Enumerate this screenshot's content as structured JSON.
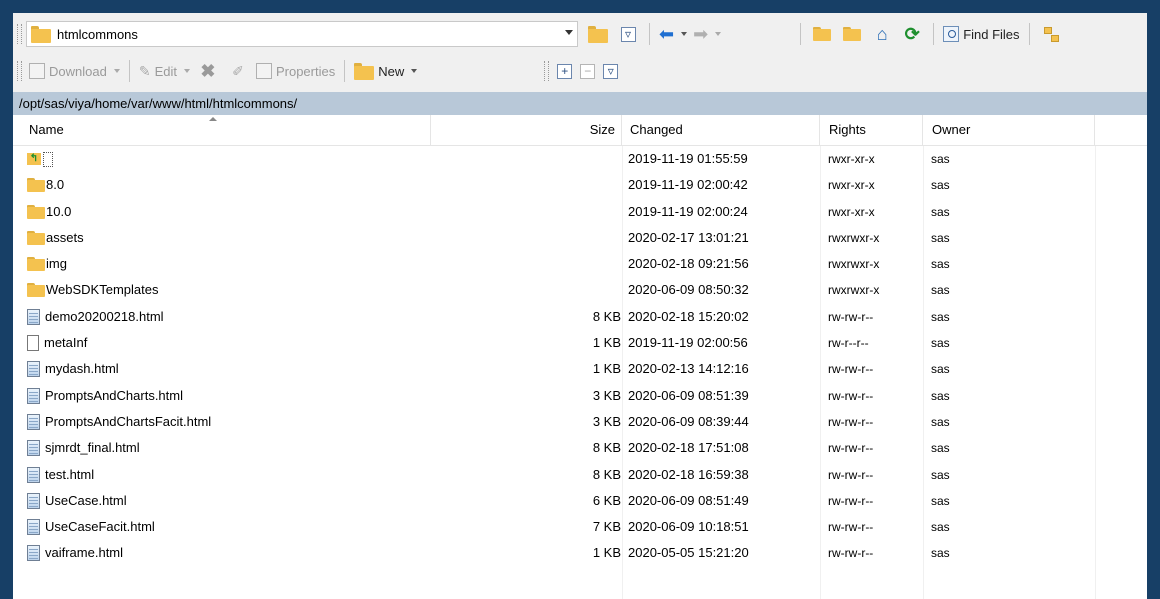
{
  "toolbar": {
    "current_folder": "htmlcommons",
    "nav_back_label": "←",
    "find_files_label": "Find Files",
    "download_label": "Download",
    "edit_label": "Edit",
    "properties_label": "Properties",
    "new_label": "New"
  },
  "address": {
    "path": "/opt/sas/viya/home/var/www/html/htmlcommons/"
  },
  "columns": {
    "name": "Name",
    "size": "Size",
    "changed": "Changed",
    "rights": "Rights",
    "owner": "Owner"
  },
  "files": [
    {
      "name": "..",
      "size": "",
      "changed": "2019-11-19 01:55:59",
      "rights": "rwxr-xr-x",
      "owner": "sas",
      "icon": "parent-folder-icon"
    },
    {
      "name": "8.0",
      "size": "",
      "changed": "2019-11-19 02:00:42",
      "rights": "rwxr-xr-x",
      "owner": "sas",
      "icon": "folder-icon"
    },
    {
      "name": "10.0",
      "size": "",
      "changed": "2019-11-19 02:00:24",
      "rights": "rwxr-xr-x",
      "owner": "sas",
      "icon": "folder-icon"
    },
    {
      "name": "assets",
      "size": "",
      "changed": "2020-02-17 13:01:21",
      "rights": "rwxrwxr-x",
      "owner": "sas",
      "icon": "folder-icon"
    },
    {
      "name": "img",
      "size": "",
      "changed": "2020-02-18 09:21:56",
      "rights": "rwxrwxr-x",
      "owner": "sas",
      "icon": "folder-icon"
    },
    {
      "name": "WebSDKTemplates",
      "size": "",
      "changed": "2020-06-09 08:50:32",
      "rights": "rwxrwxr-x",
      "owner": "sas",
      "icon": "folder-icon"
    },
    {
      "name": "demo20200218.html",
      "size": "8 KB",
      "changed": "2020-02-18 15:20:02",
      "rights": "rw-rw-r--",
      "owner": "sas",
      "icon": "html-file-icon"
    },
    {
      "name": "metaInf",
      "size": "1 KB",
      "changed": "2019-11-19 02:00:56",
      "rights": "rw-r--r--",
      "owner": "sas",
      "icon": "file-icon"
    },
    {
      "name": "mydash.html",
      "size": "1 KB",
      "changed": "2020-02-13 14:12:16",
      "rights": "rw-rw-r--",
      "owner": "sas",
      "icon": "html-file-icon"
    },
    {
      "name": "PromptsAndCharts.html",
      "size": "3 KB",
      "changed": "2020-06-09 08:51:39",
      "rights": "rw-rw-r--",
      "owner": "sas",
      "icon": "html-file-icon"
    },
    {
      "name": "PromptsAndChartsFacit.html",
      "size": "3 KB",
      "changed": "2020-06-09 08:39:44",
      "rights": "rw-rw-r--",
      "owner": "sas",
      "icon": "html-file-icon"
    },
    {
      "name": "sjmrdt_final.html",
      "size": "8 KB",
      "changed": "2020-02-18 17:51:08",
      "rights": "rw-rw-r--",
      "owner": "sas",
      "icon": "html-file-icon"
    },
    {
      "name": "test.html",
      "size": "8 KB",
      "changed": "2020-02-18 16:59:38",
      "rights": "rw-rw-r--",
      "owner": "sas",
      "icon": "html-file-icon"
    },
    {
      "name": "UseCase.html",
      "size": "6 KB",
      "changed": "2020-06-09 08:51:49",
      "rights": "rw-rw-r--",
      "owner": "sas",
      "icon": "html-file-icon"
    },
    {
      "name": "UseCaseFacit.html",
      "size": "7 KB",
      "changed": "2020-06-09 10:18:51",
      "rights": "rw-rw-r--",
      "owner": "sas",
      "icon": "html-file-icon"
    },
    {
      "name": "vaiframe.html",
      "size": "1 KB",
      "changed": "2020-05-05 15:21:20",
      "rights": "rw-rw-r--",
      "owner": "sas",
      "icon": "html-file-icon"
    }
  ]
}
